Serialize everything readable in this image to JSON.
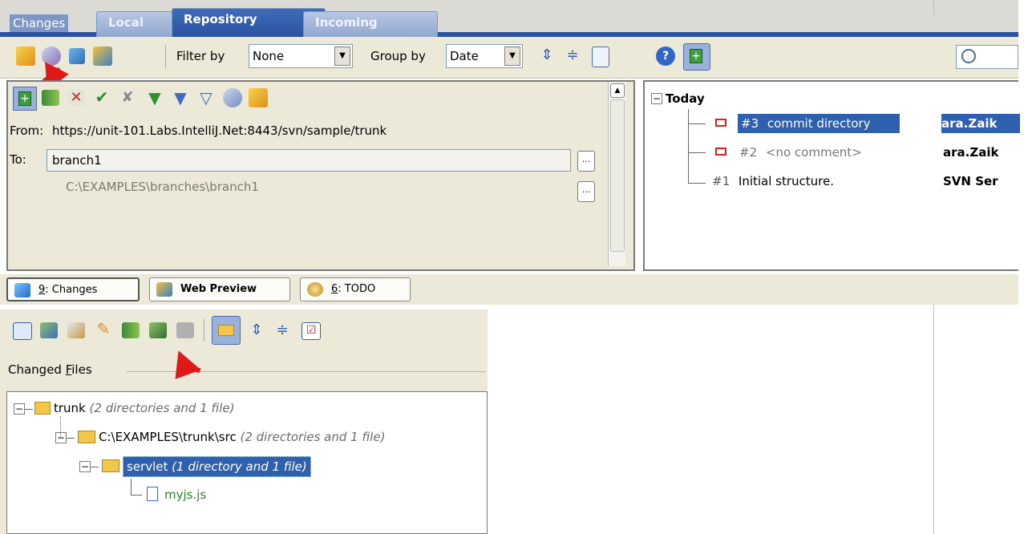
{
  "tabs": {
    "changes": "Changes",
    "local": "Local",
    "repository": "Repository",
    "incoming": "Incoming"
  },
  "toolbar": {
    "filter_label": "Filter by",
    "filter_value": "None",
    "group_label": "Group by",
    "group_value": "Date"
  },
  "branch": {
    "from_label": "From:",
    "from_url": "https://unit-101.Labs.IntelliJ.Net:8443/svn/sample/trunk",
    "to_label": "To:",
    "to_value": "branch1",
    "local_path": "C:\\EXAMPLES\\branches\\branch1",
    "browse": "..."
  },
  "history": {
    "group": "Today",
    "items": [
      {
        "rev": "#3",
        "message": "commit directory",
        "author": "ara.Zaik"
      },
      {
        "rev": "#2",
        "message": "<no comment>",
        "author": "ara.Zaik"
      },
      {
        "rev": "#1",
        "message": "Initial structure.",
        "author": "SVN Ser"
      }
    ]
  },
  "toolwindows": [
    {
      "label": "9: Changes",
      "mnemonic": "9",
      "rest": ": Changes"
    },
    {
      "label": "Web Preview"
    },
    {
      "label": "6: TODO",
      "mnemonic": "6",
      "rest": ": TODO"
    }
  ],
  "changed_files": {
    "title": "Changed Files",
    "title_mnemonic": "F",
    "tree": [
      {
        "name": "trunk",
        "meta": "(2 directories and 1 file)"
      },
      {
        "name": "C:\\EXAMPLES\\trunk\\src",
        "meta": "(2 directories and 1 file)"
      },
      {
        "name": "servlet",
        "meta": "(1 directory and 1 file)"
      },
      {
        "name": "myjs.js",
        "meta": ""
      }
    ]
  },
  "colors": {
    "tab_active": "#2a52a0",
    "selection": "#2f5faf",
    "file_green": "#2a8a2a",
    "arrow_red": "#e01818"
  }
}
